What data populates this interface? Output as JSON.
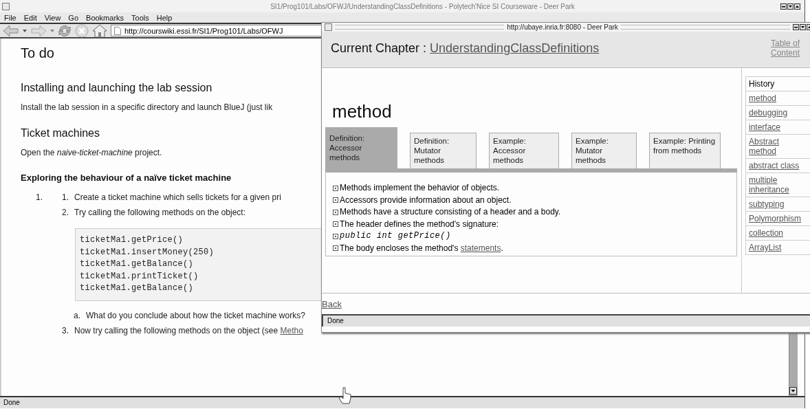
{
  "main_window": {
    "title": "SI1/Prog101/Labs/OFWJ/UnderstandingClassDefinitions - Polytech'Nice SI Courseware - Deer Park",
    "menu": [
      "File",
      "Edit",
      "View",
      "Go",
      "Bookmarks",
      "Tools",
      "Help"
    ],
    "url": "http://courswiki.essi.fr/SI1/Prog101/Labs/OFWJ",
    "heading": "To do",
    "section_1": {
      "title": "Installing and launching the lab session",
      "text": "Install the lab session in a specific directory and launch BlueJ (just lik"
    },
    "section_2": {
      "title": "Ticket machines",
      "text": "Open the *naive-ticket-machine* project."
    },
    "subsection": {
      "title": "Exploring the behaviour of a naïve ticket machine",
      "outer_number": "1.",
      "steps": [
        {
          "number": "1.",
          "text": "Create a ticket machine which sells tickets for a given pri"
        },
        {
          "number": "2.",
          "text": "Try calling the following methods on the object:"
        }
      ],
      "code": [
        "ticketMa1.getPrice()",
        "ticketMa1.insertMoney(250)",
        "ticketMa1.getBalance()",
        "ticketMa1.printTicket()",
        "ticketMa1.getBalance()"
      ],
      "question": {
        "number": "a.",
        "text": "What do you conclude about how the ticket machine works?"
      },
      "last_step": {
        "number": "3.",
        "text": "Now try calling the following methods on the object (see ",
        "link": "Metho"
      }
    },
    "status_bar": "Done"
  },
  "popup_window": {
    "title": "http://ubaye.inria.fr:8080 - Deer Park",
    "chapter_label": "Current Chapter :",
    "chapter_link": "UnderstandingClassDefinitions",
    "toc_link": "Table of Content",
    "heading": "method",
    "tabs": [
      {
        "label": "Definition: Accessor methods",
        "selected": true
      },
      {
        "label": "Definition: Mutator methods",
        "selected": false
      },
      {
        "label": "Example: Accessor methods",
        "selected": false
      },
      {
        "label": "Example: Mutator methods",
        "selected": false
      },
      {
        "label": "Example: Printing from methods",
        "selected": false
      }
    ],
    "bullets": [
      {
        "kind": "text",
        "text": "Methods implement the behavior of objects."
      },
      {
        "kind": "text",
        "text": "Accessors provide information about an object."
      },
      {
        "kind": "text",
        "text": "Methods have a structure consisting of a header and a body."
      },
      {
        "kind": "text",
        "text": "The header defines the method's signature:"
      },
      {
        "kind": "code",
        "text": "public int getPrice()"
      },
      {
        "kind": "link",
        "text": "The body encloses the method's ",
        "link": "statements",
        "after": "."
      }
    ],
    "sidebar": [
      {
        "kind": "plain",
        "label": "History"
      },
      {
        "kind": "link",
        "label": "method"
      },
      {
        "kind": "link",
        "label": "debugging"
      },
      {
        "kind": "link",
        "label": "interface"
      },
      {
        "kind": "link",
        "label": "Abstract method"
      },
      {
        "kind": "link",
        "label": "abstract class"
      },
      {
        "kind": "link",
        "label": "multiple inheritance"
      },
      {
        "kind": "link",
        "label": "subtyping"
      },
      {
        "kind": "link",
        "label": "Polymorphism"
      },
      {
        "kind": "link",
        "label": "collection"
      },
      {
        "kind": "link",
        "label": "ArrayList"
      }
    ],
    "back_link": "Back",
    "status_bar": "Done"
  }
}
